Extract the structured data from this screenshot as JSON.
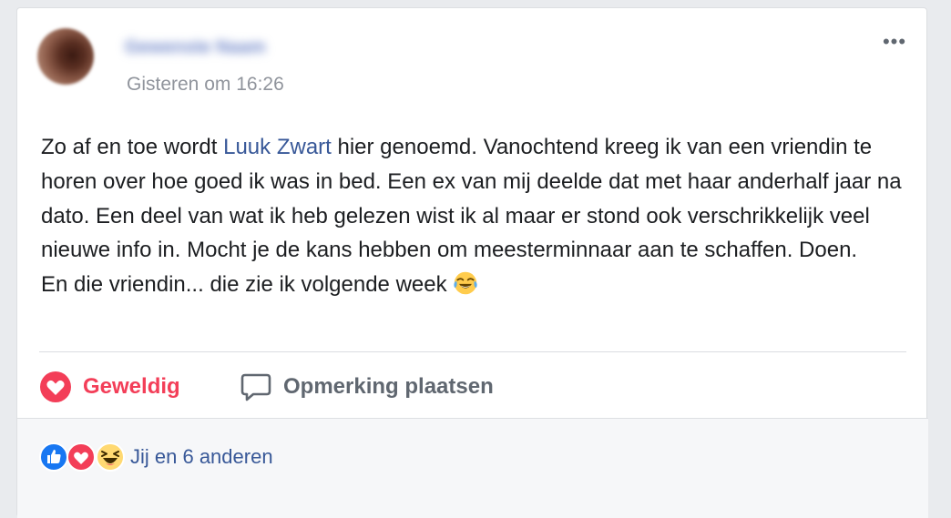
{
  "post": {
    "author": "Gewenste Naam",
    "timestamp": "Gisteren om 16:26",
    "text": {
      "line1_before": "Zo af en toe wordt ",
      "mention": "Luuk Zwart",
      "line1_after": " hier genoemd. Vanochtend kreeg ik van een vriendin te horen over hoe goed ik was in bed. Een ex van mij deelde dat met haar anderhalf jaar na dato. Een deel van wat ik heb gelezen wist ik al maar er stond ook verschrikkelijk veel nieuwe info in. Mocht je de kans hebben om meesterminnaar aan te schaffen. Doen.",
      "line2": "En die vriendin... die zie ik volgende week ",
      "emoji": "face-with-tears-of-joy"
    },
    "more_menu_icon": "more-horizontal-icon"
  },
  "actions": {
    "react_label": "Geweldig",
    "react_icon": "heart-icon",
    "comment_label": "Opmerking plaatsen",
    "comment_icon": "speech-bubble-icon"
  },
  "reactions": {
    "icons": [
      "like-icon",
      "heart-icon",
      "haha-icon"
    ],
    "summary": "Jij en 6 anderen"
  },
  "colors": {
    "love_red": "#f33e58",
    "link_blue": "#385898",
    "like_blue": "#1877f2",
    "muted_gray": "#90949c",
    "text_dark": "#1c1e21"
  }
}
